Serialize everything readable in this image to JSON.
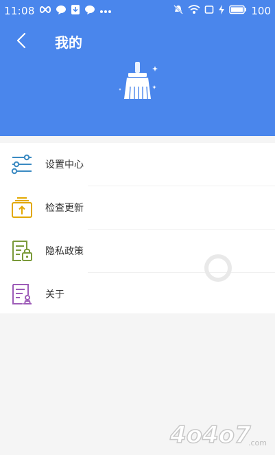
{
  "status_bar": {
    "time": "11:08",
    "battery": "100",
    "left_icons": [
      "infinity-icon",
      "chat-bubble-icon",
      "download-icon",
      "chat-bubble-icon",
      "more-dots-icon"
    ],
    "right_icons": [
      "mute-icon",
      "wifi-icon",
      "square-icon",
      "charging-bolt-icon",
      "battery-icon"
    ]
  },
  "header": {
    "title": "我的",
    "back_icon": "back-chevron-icon",
    "hero_icon": "broom-icon",
    "background_color": "#4a86ec"
  },
  "menu": {
    "items": [
      {
        "label": "设置中心",
        "icon": "settings-sliders-icon",
        "color": "#3a8ac2"
      },
      {
        "label": "检查更新",
        "icon": "update-box-icon",
        "color": "#e2a800"
      },
      {
        "label": "隐私政策",
        "icon": "privacy-lock-icon",
        "color": "#7a9a3a"
      },
      {
        "label": "关于",
        "icon": "about-document-icon",
        "color": "#9d5cb8"
      }
    ]
  },
  "loading": {
    "icon": "loading-spinner-icon"
  },
  "watermark": {
    "text": "4o4o7.com"
  }
}
